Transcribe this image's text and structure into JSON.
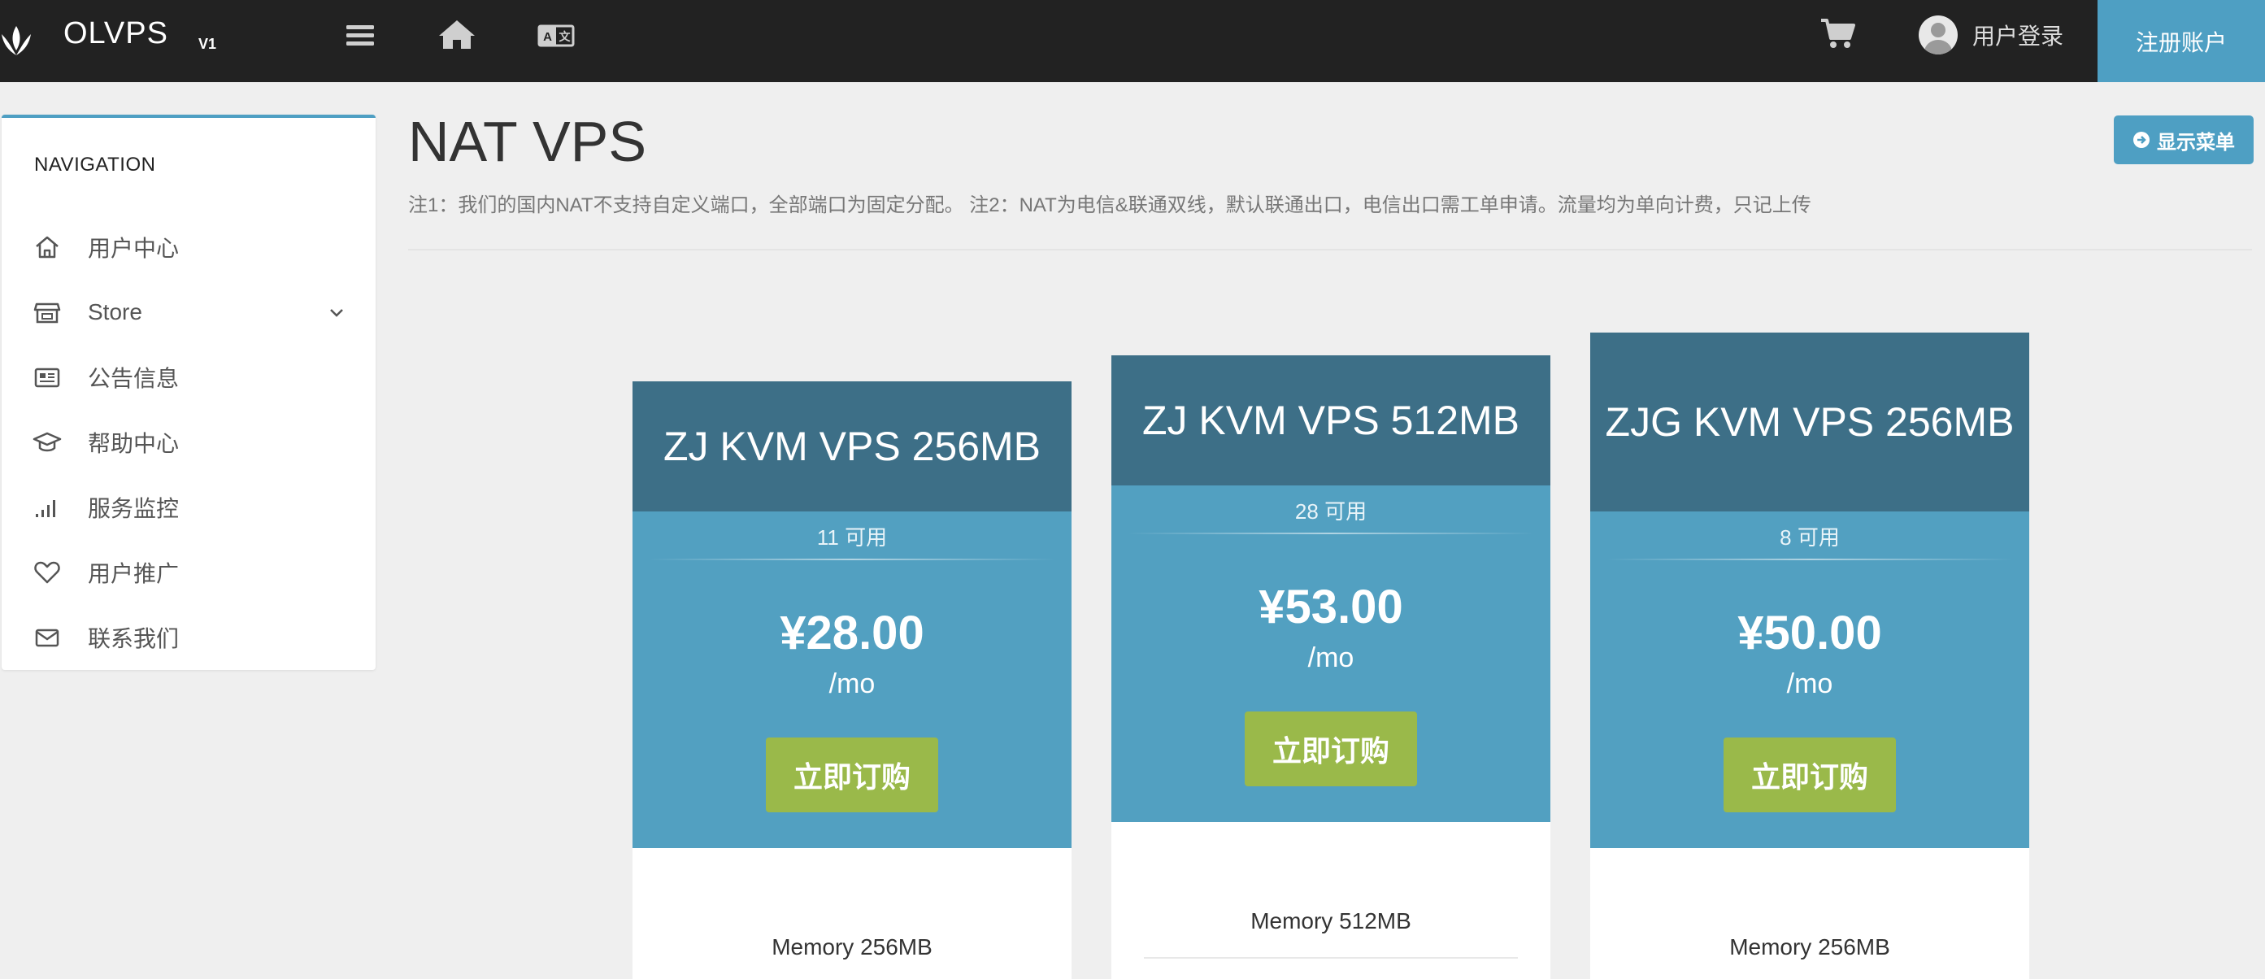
{
  "header": {
    "brand": "OLVPS",
    "version": "V1",
    "login_label": "用户登录",
    "register_label": "注册账户"
  },
  "sidebar": {
    "title": "NAVIGATION",
    "items": [
      {
        "label": "用户中心",
        "icon": "home-icon"
      },
      {
        "label": "Store",
        "icon": "store-icon",
        "has_submenu": true
      },
      {
        "label": "公告信息",
        "icon": "newspaper-icon"
      },
      {
        "label": "帮助中心",
        "icon": "graduation-cap-icon"
      },
      {
        "label": "服务监控",
        "icon": "signal-bars-icon"
      },
      {
        "label": "用户推广",
        "icon": "heart-icon"
      },
      {
        "label": "联系我们",
        "icon": "envelope-icon"
      }
    ]
  },
  "main": {
    "title": "NAT VPS",
    "note": "注1：我们的国内NAT不支持自定义端口，全部端口为固定分配。 注2：NAT为电信&联通双线，默认联通出口，电信出口需工单申请。流量均为单向计费，只记上传",
    "show_menu_label": "显示菜单"
  },
  "products": [
    {
      "name": "ZJ KVM VPS 256MB",
      "availability": "11 可用",
      "price": "¥28.00",
      "period": "/mo",
      "order_label": "立即订购",
      "feature": "Memory 256MB"
    },
    {
      "name": "ZJ KVM VPS 512MB",
      "availability": "28 可用",
      "price": "¥53.00",
      "period": "/mo",
      "order_label": "立即订购",
      "feature": "Memory 512MB"
    },
    {
      "name": "ZJG KVM VPS 256MB",
      "availability": "8 可用",
      "price": "¥50.00",
      "period": "/mo",
      "order_label": "立即订购",
      "feature": "Memory 256MB"
    }
  ],
  "colors": {
    "topbar": "#222222",
    "accent": "#4e9fc3",
    "card_head": "#3d6f87",
    "card_body": "#52a0c1",
    "order_button": "#9ab94a"
  }
}
